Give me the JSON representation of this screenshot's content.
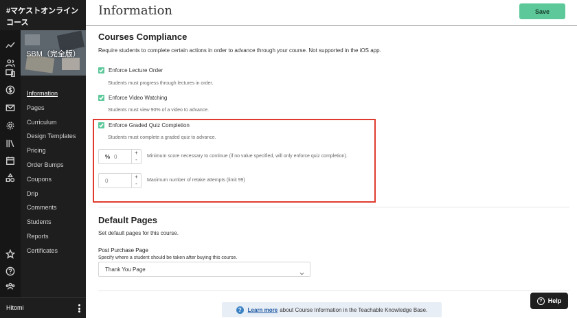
{
  "sidebar": {
    "school_name": "#マケストオンラインコース",
    "course_thumb_text": "SBM（完全版）",
    "nav": [
      {
        "label": "Information",
        "active": true
      },
      {
        "label": "Pages"
      },
      {
        "label": "Curriculum"
      },
      {
        "label": "Design Templates"
      },
      {
        "label": "Pricing"
      },
      {
        "label": "Order Bumps"
      },
      {
        "label": "Coupons"
      },
      {
        "label": "Drip"
      },
      {
        "label": "Comments"
      },
      {
        "label": "Students"
      },
      {
        "label": "Reports"
      },
      {
        "label": "Certificates"
      }
    ],
    "rail_icons": [
      "chart-line-icon",
      "users-icon",
      "devices-icon",
      "dollar-icon",
      "mail-icon",
      "gear-icon",
      "library-icon",
      "calendar-icon",
      "shapes-icon",
      "star-icon",
      "help-circle-icon",
      "community-icon"
    ],
    "user_name": "Hitomi"
  },
  "header": {
    "title": "Information",
    "save_label": "Save"
  },
  "compliance": {
    "title": "Courses Compliance",
    "description": "Require students to complete certain actions in order to advance through your course. Not supported in the iOS app.",
    "lecture_order": {
      "label": "Enforce Lecture Order",
      "hint": "Students must progress through lectures in order.",
      "checked": true
    },
    "video_watching": {
      "label": "Enforce Video Watching",
      "hint": "Students must view 90% of a video to advance.",
      "checked": true
    },
    "quiz_completion": {
      "label": "Enforce Graded Quiz Completion",
      "hint": "Students must complete a graded quiz to advance.",
      "checked": true
    },
    "min_score": {
      "prefix": "%",
      "value": "0",
      "hint": "Minimum score necessary to continue (if no value specified, will only enforce quiz completion)."
    },
    "retakes": {
      "value": "0",
      "hint": "Maximum number of retake attempts (limit 99)"
    },
    "plus": "+",
    "minus": "-"
  },
  "default_pages": {
    "title": "Default Pages",
    "description": "Set default pages for this course.",
    "post_purchase_label": "Post Purchase Page",
    "post_purchase_hint": "Specify where a student should be taken after buying this course.",
    "post_purchase_value": "Thank You Page"
  },
  "kb_banner": {
    "link": "Learn more",
    "text": "about Course Information in the Teachable Knowledge Base."
  },
  "help": {
    "label": "Help"
  },
  "colors": {
    "accent": "#5dc99a",
    "highlight": "#e03a2f",
    "sidebar": "#1e1e1e"
  }
}
